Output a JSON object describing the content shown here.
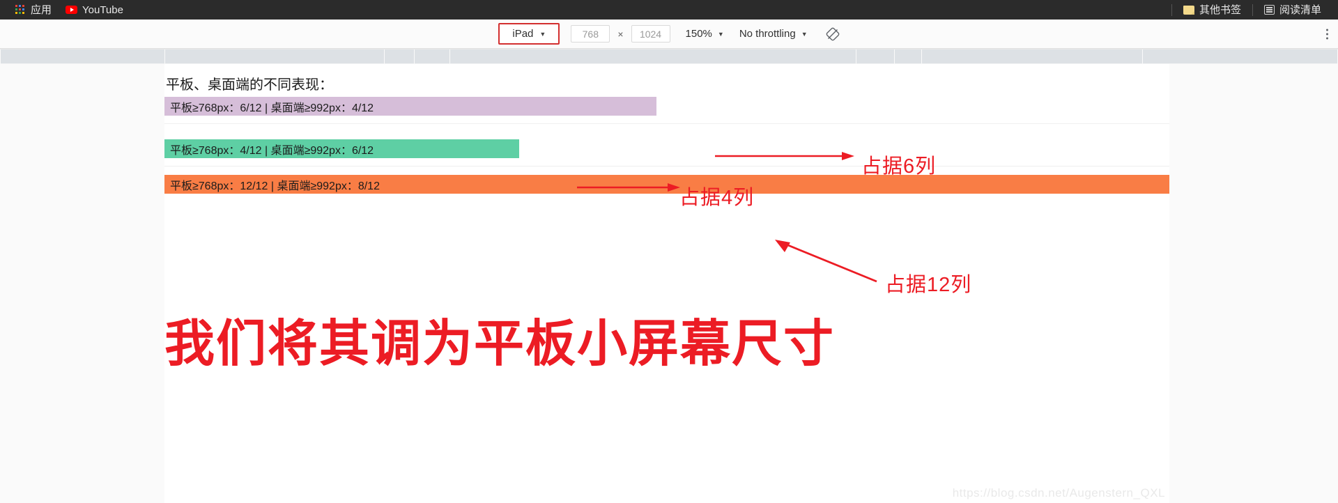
{
  "bookmarks_bar": {
    "left_items": [
      {
        "icon": "apps-grid-icon",
        "label": "应用"
      },
      {
        "icon": "youtube-icon",
        "label": "YouTube"
      }
    ],
    "right_items": [
      {
        "icon": "folder-icon",
        "label": "其他书签"
      },
      {
        "icon": "reading-list-icon",
        "label": "阅读清单"
      }
    ]
  },
  "device_toolbar": {
    "device": "iPad",
    "caret": "▼",
    "width": "768",
    "multiply": "×",
    "height": "1024",
    "zoom": "150%",
    "throttling": "No throttling",
    "rotate_icon": "rotate-icon",
    "menu_icon": "kebab-menu-icon",
    "highlight_color": "#d32f2f"
  },
  "page": {
    "title": "平板、桌面端的不同表现：",
    "bars": [
      {
        "text": "平板≥768px：6/12 | 桌面端≥992px：4/12",
        "color": "#d6bed9",
        "columns_tablet": "6/12",
        "columns_desktop": "4/12"
      },
      {
        "text": "平板≥768px：4/12 | 桌面端≥992px：6/12",
        "color": "#5ecfa4",
        "columns_tablet": "4/12",
        "columns_desktop": "6/12"
      },
      {
        "text": "平板≥768px：12/12 | 桌面端≥992px：8/12",
        "color": "#f97d45",
        "columns_tablet": "12/12",
        "columns_desktop": "8/12"
      }
    ],
    "annotations": [
      {
        "text": "占据6列"
      },
      {
        "text": "占据4列"
      },
      {
        "text": "占据12列"
      }
    ],
    "headline": "我们将其调为平板小屏幕尺寸",
    "annotation_color": "#ec1c24",
    "watermark": "https://blog.csdn.net/Augenstern_QXL"
  }
}
